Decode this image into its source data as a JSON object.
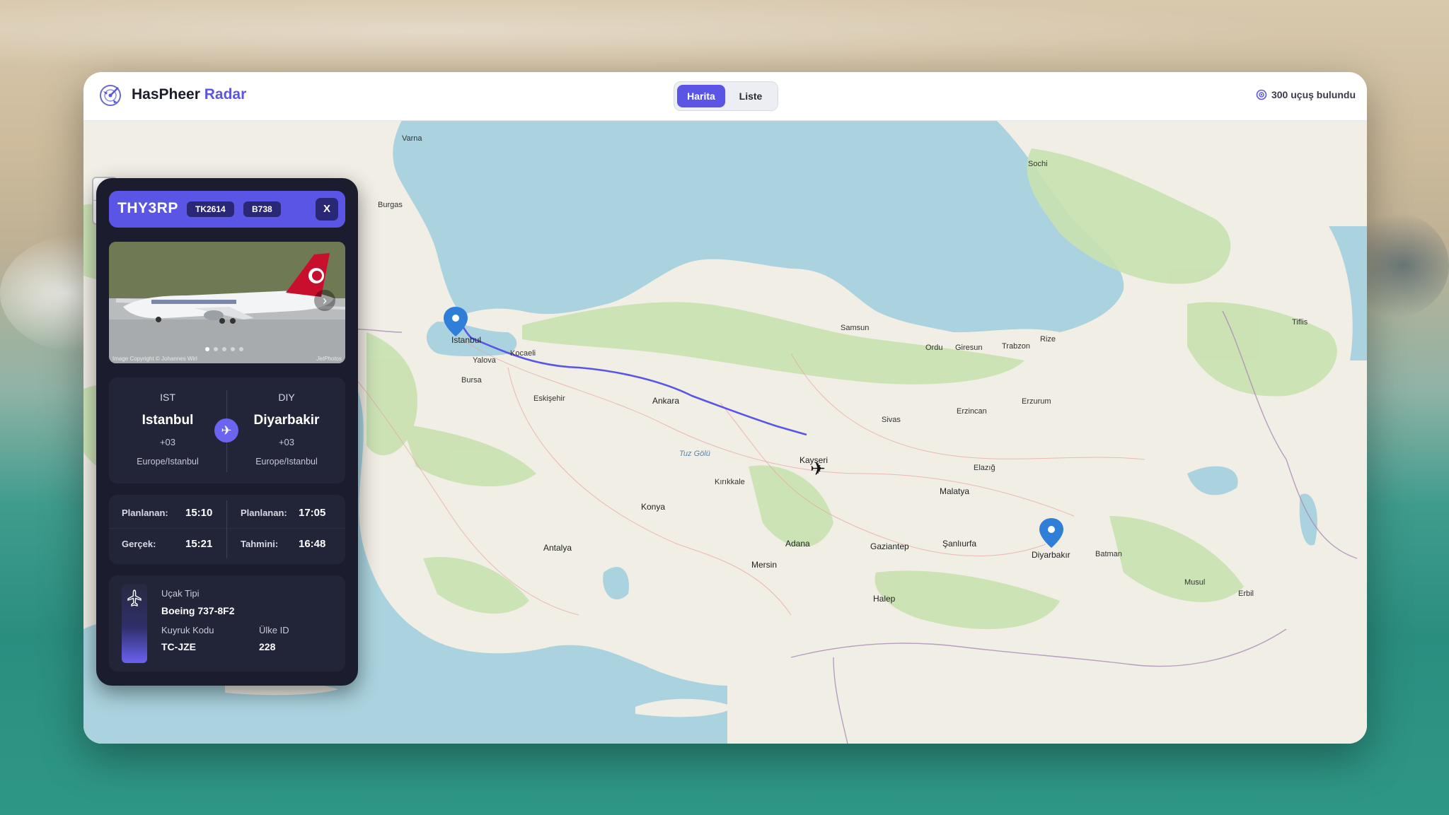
{
  "app": {
    "brand_main": "HasPheer",
    "brand_accent": "Radar",
    "view_tabs": [
      "Harita",
      "Liste"
    ],
    "active_tab": "Harita",
    "flight_count": "300 uçuş bulundu",
    "accent_color": "#5b55e6"
  },
  "map": {
    "zoom_in": "+",
    "zoom_out": "−",
    "labels": [
      "Varna",
      "Burgas",
      "Sochi",
      "Tiflis",
      "Samsun",
      "Istanbul",
      "Kocaeli",
      "Yalova",
      "Bursa",
      "Eskişehir",
      "Ankara",
      "Sivas",
      "Erzurum",
      "Erzincan",
      "Ordu",
      "Giresun",
      "Trabzon",
      "Rize",
      "Kayseri",
      "Tuz Gölü",
      "Kırıkkale",
      "Konya",
      "Elazığ",
      "Malatya",
      "Diyarbakır",
      "Batman",
      "Adana",
      "Gaziantep",
      "Şanlıurfa",
      "Mersin",
      "Antalya",
      "Halep",
      "Musul",
      "Erbil"
    ]
  },
  "flight": {
    "callsign": "THY3RP",
    "flight_no": "TK2614",
    "aircraft_code": "B738",
    "close_label": "X",
    "photo_credit": "Image Copyright © Johannes Wirl",
    "photo_source": "JetPhotos",
    "origin": {
      "code": "IST",
      "city": "Istanbul",
      "offset": "+03",
      "timezone": "Europe/Istanbul"
    },
    "destination": {
      "code": "DIY",
      "city": "Diyarbakir",
      "offset": "+03",
      "timezone": "Europe/Istanbul"
    },
    "times": {
      "dep_sched_label": "Planlanan:",
      "dep_sched": "15:10",
      "arr_sched_label": "Planlanan:",
      "arr_sched": "17:05",
      "dep_actual_label": "Gerçek:",
      "dep_actual": "15:21",
      "arr_est_label": "Tahmini:",
      "arr_est": "16:48"
    },
    "aircraft": {
      "type_label": "Uçak Tipi",
      "type": "Boeing 737-8F2",
      "tail_label": "Kuyruk Kodu",
      "tail": "TC-JZE",
      "country_label": "Ülke ID",
      "country": "228"
    }
  }
}
